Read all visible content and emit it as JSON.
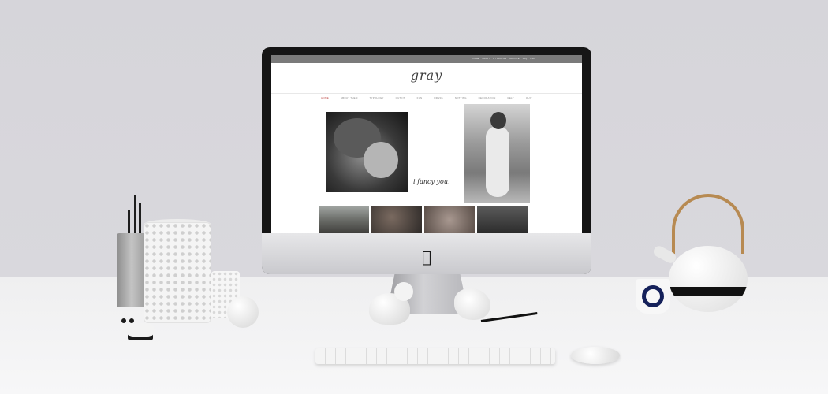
{
  "website": {
    "utility_links": [
      "HOME",
      "ABOUT",
      "MY PROFILE",
      "ARCHIVE",
      "FAQ",
      "ASK"
    ],
    "logo": "gray",
    "nav": [
      "HOME",
      "ABOUT THEM",
      "TYPOLOGY",
      "OUTFIT",
      "FUN",
      "DRESS",
      "NOTTING",
      "DECORATION",
      "RELY",
      "QUIT"
    ],
    "active_nav_index": 0,
    "tagline": "i fancy you."
  },
  "brand_icon": "apple-logo-icon",
  "colors": {
    "wall": "#d9d8dd",
    "desk": "#f2f2f3",
    "nav_active": "#c0504d",
    "top_bar": "#7a7a7a"
  }
}
